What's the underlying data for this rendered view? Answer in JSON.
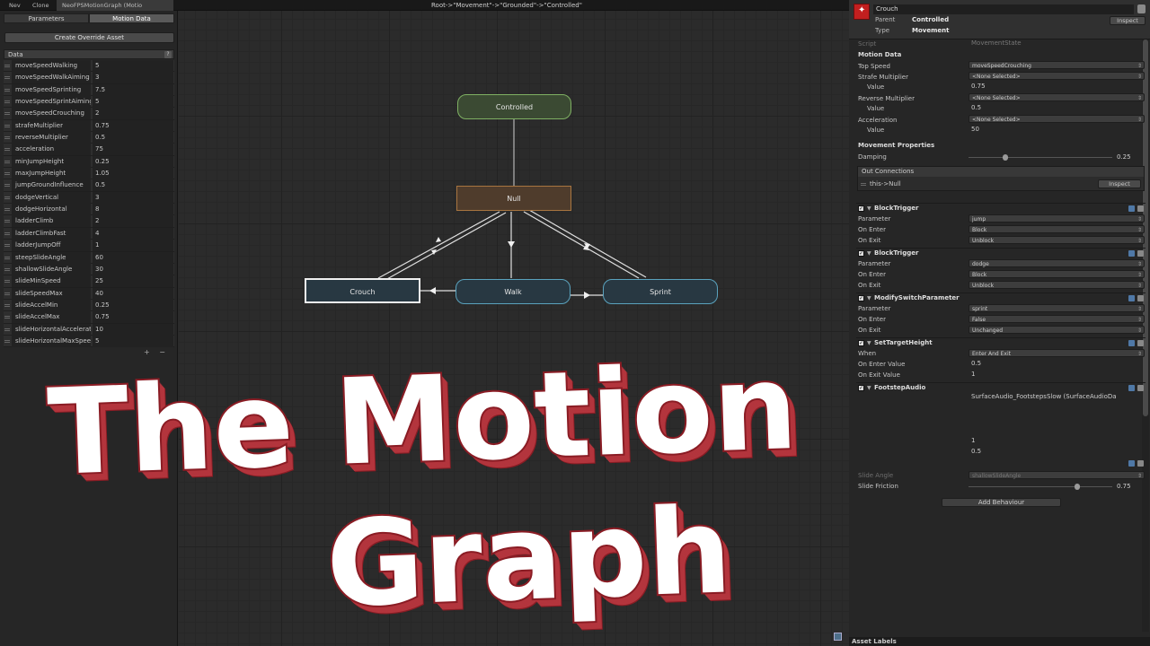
{
  "topbar": {
    "tabs": [
      "Nev",
      "Clone",
      "NeoFPSMotionGraph (Motio"
    ],
    "breadcrumb": "Root->\"Movement\"->\"Grounded\"->\"Controlled\""
  },
  "left_panel": {
    "tabs": [
      "Parameters",
      "Motion Data"
    ],
    "active_tab": "Motion Data",
    "override_button": "Create Override Asset",
    "data_header": "Data",
    "rows": [
      {
        "name": "moveSpeedWalking",
        "value": "5"
      },
      {
        "name": "moveSpeedWalkAiming",
        "value": "3"
      },
      {
        "name": "moveSpeedSprinting",
        "value": "7.5"
      },
      {
        "name": "moveSpeedSprintAiming",
        "value": "5"
      },
      {
        "name": "moveSpeedCrouching",
        "value": "2"
      },
      {
        "name": "strafeMultiplier",
        "value": "0.75"
      },
      {
        "name": "reverseMultiplier",
        "value": "0.5"
      },
      {
        "name": "acceleration",
        "value": "75"
      },
      {
        "name": "minJumpHeight",
        "value": "0.25"
      },
      {
        "name": "maxJumpHeight",
        "value": "1.05"
      },
      {
        "name": "jumpGroundInfluence",
        "value": "0.5"
      },
      {
        "name": "dodgeVertical",
        "value": "3"
      },
      {
        "name": "dodgeHorizontal",
        "value": "8"
      },
      {
        "name": "ladderClimb",
        "value": "2"
      },
      {
        "name": "ladderClimbFast",
        "value": "4"
      },
      {
        "name": "ladderJumpOff",
        "value": "1"
      },
      {
        "name": "steepSlideAngle",
        "value": "60"
      },
      {
        "name": "shallowSlideAngle",
        "value": "30"
      },
      {
        "name": "slideMinSpeed",
        "value": "25"
      },
      {
        "name": "slideSpeedMax",
        "value": "40"
      },
      {
        "name": "slideAccelMin",
        "value": "0.25"
      },
      {
        "name": "slideAccelMax",
        "value": "0.75"
      },
      {
        "name": "slideHorizontalAcceleration",
        "value": "10"
      },
      {
        "name": "slideHorizontalMaxSpeed",
        "value": "5"
      }
    ],
    "footer_add": "+",
    "footer_remove": "−"
  },
  "graph": {
    "nodes": {
      "controlled": "Controlled",
      "null": "Null",
      "crouch": "Crouch",
      "walk": "Walk",
      "sprint": "Sprint"
    }
  },
  "inspector": {
    "name": "Crouch",
    "parent_label": "Parent",
    "parent_value": "Controlled",
    "type_label": "Type",
    "type_value": "Movement",
    "inspect_button": "Inspect",
    "script_label": "Script",
    "script_value": "MovementState",
    "motion_data_header": "Motion Data",
    "top_speed_label": "Top Speed",
    "top_speed_value": "moveSpeedCrouching",
    "strafe_label": "Strafe Multiplier",
    "strafe_value": "<None Selected>",
    "strafe_num_label": "Value",
    "strafe_num": "0.75",
    "reverse_label": "Reverse Multiplier",
    "reverse_value": "<None Selected>",
    "reverse_num_label": "Value",
    "reverse_num": "0.5",
    "accel_label": "Acceleration",
    "accel_value": "<None Selected>",
    "accel_num_label": "Value",
    "accel_num": "50",
    "movement_props_header": "Movement Properties",
    "damping_label": "Damping",
    "damping_value": "0.25",
    "out_conn_header": "Out Connections",
    "out_conn_row": "this->Null",
    "out_conn_button": "Inspect",
    "behaviours": [
      {
        "title": "BlockTrigger",
        "rows": [
          [
            "Parameter",
            "jump"
          ],
          [
            "On Enter",
            "Block"
          ],
          [
            "On Exit",
            "Unblock"
          ]
        ]
      },
      {
        "title": "BlockTrigger",
        "rows": [
          [
            "Parameter",
            "dodge"
          ],
          [
            "On Enter",
            "Block"
          ],
          [
            "On Exit",
            "Unblock"
          ]
        ]
      },
      {
        "title": "ModifySwitchParameter",
        "rows": [
          [
            "Parameter",
            "sprint"
          ],
          [
            "On Enter",
            "False"
          ],
          [
            "On Exit",
            "Unchanged"
          ]
        ]
      },
      {
        "title": "SetTargetHeight",
        "rows": [
          [
            "When",
            "Enter And Exit"
          ],
          [
            "On Enter Value",
            "0.5"
          ],
          [
            "On Exit Value",
            "1"
          ]
        ]
      }
    ],
    "partial_behaviour_title": "FootstepAudio",
    "footstep_value": "SurfaceAudio_FootstepsSlow (SurfaceAudioDa",
    "hidden_val_1": "1",
    "hidden_val_2": "0.5",
    "slide_angle_label": "Slide Angle",
    "slide_angle_value": "shallowSlideAngle",
    "slide_friction_label": "Slide Friction",
    "slide_friction_value": "0.75",
    "add_behaviour_button": "Add Behaviour",
    "asset_labels": "Asset Labels"
  },
  "overlay_title": {
    "line1": "The Motion",
    "line2": "Graph"
  },
  "colors": {
    "title_face": "#ffffff",
    "title_side": "#b3353d",
    "title_outline": "#8a1c24",
    "controlled_border": "#7fb063",
    "null_border": "#a87540",
    "walk_border": "#5aa2bd"
  }
}
